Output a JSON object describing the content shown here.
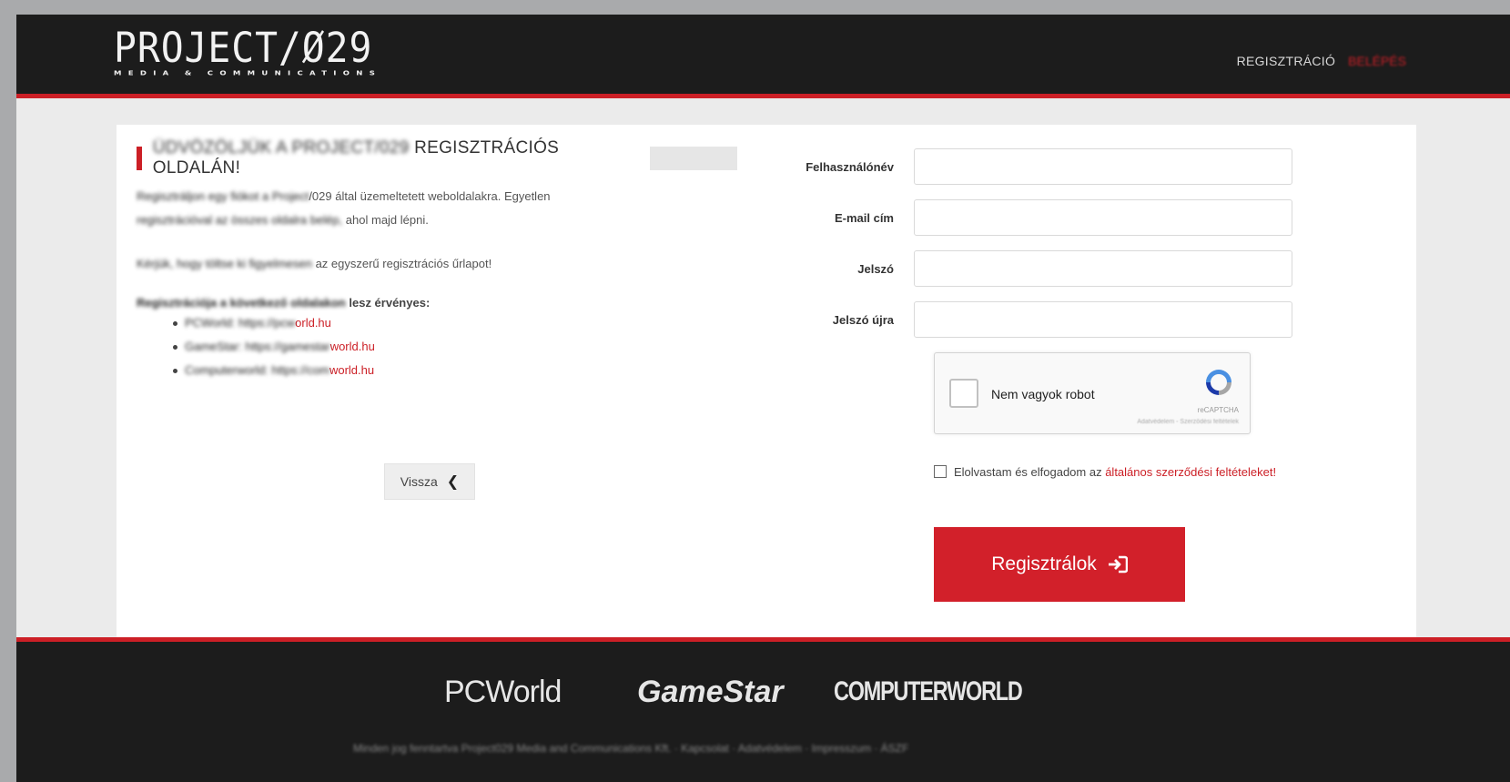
{
  "header": {
    "logo_main": "PROJECT/Ø29",
    "logo_sub": "MEDIA & COMMUNICATIONS",
    "nav_register": "REGISZTRÁCIÓ",
    "nav_login": "BELÉPÉS"
  },
  "left": {
    "heading_blurred": "ÜDVÖZÖLJÜK A PROJECT/029 ",
    "heading_visible": "REGISZTRÁCIÓS OLDALÁN!",
    "para1_blurred": "Regisztráljon egy fiókot a Project",
    "para1_visible": "/029 által üzemeltetett weboldalakra. Egyetlen",
    "para1b_blurred": "regisztrációval az összes oldalra belép,",
    "para1b_visible": "ahol majd lépni.",
    "para2_blurred": "Kérjük, hogy töltse ki figyelmesen",
    "para2_visible": "az egyszerű regisztrációs űrlapot!",
    "list_blurred": "Regisztrációja a következő oldalakon",
    "list_visible": "lesz érvényes:",
    "sites": [
      {
        "blurred": "PCWorld: https://pcw",
        "visible": "orld.hu"
      },
      {
        "blurred": "GameStar: https://gamestar",
        "visible": "world.hu"
      },
      {
        "blurred": "Computerworld: https://com",
        "visible": "world.hu"
      }
    ],
    "back_label": "Vissza",
    "back_icon": "chevron-left-icon"
  },
  "form": {
    "username_label": "Felhasználónév",
    "email_label": "E-mail cím",
    "password_label": "Jelszó",
    "password_again_label": "Jelszó újra",
    "captcha_label": "Nem vagyok robot",
    "captcha_brand": "reCAPTCHA",
    "captcha_links": "Adatvédelem - Szerződési feltételek",
    "terms_text": "Elolvastam és elfogadom az ",
    "terms_link": "általános szerződési feltételeket!",
    "submit_label": "Regisztrálok",
    "submit_icon": "sign-in-icon"
  },
  "footer": {
    "brand_pcworld": "PCWorld",
    "brand_gamestar": "GameStar",
    "brand_computerworld": "COMPUTERWORLD",
    "bottom_text": "Minden jog fenntartva Project029 Media and Communications Kft.  ·  Kapcsolat  ·  Adatvédelem  ·  Impresszum  ·  ÁSZF"
  },
  "colors": {
    "accent": "#cc1f26",
    "dark": "#1c1c1c"
  }
}
